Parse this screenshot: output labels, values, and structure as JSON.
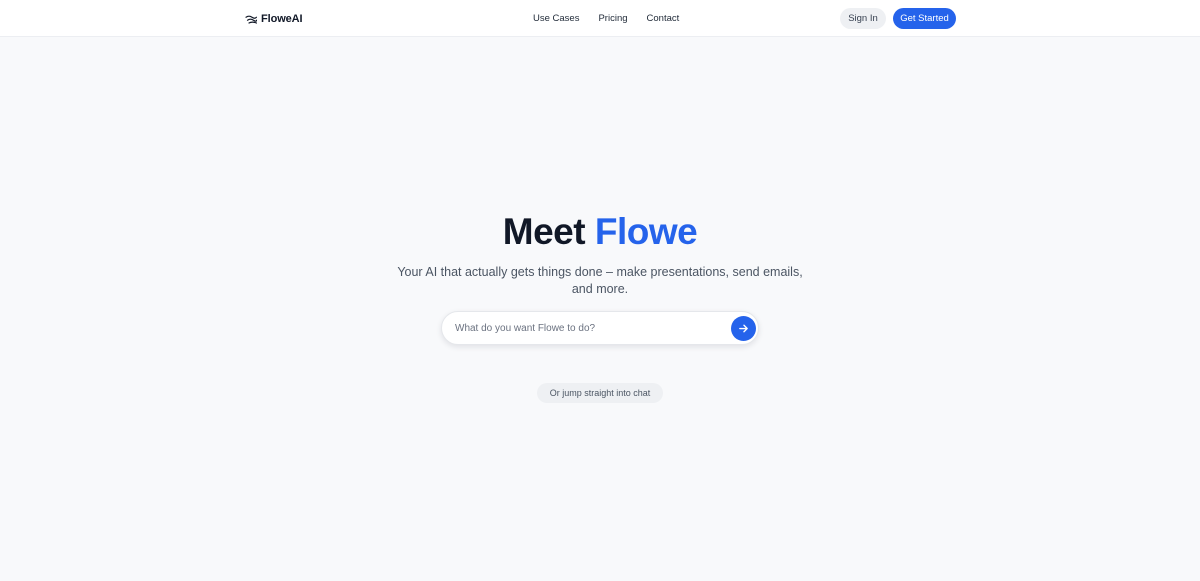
{
  "header": {
    "brand": {
      "name": "FloweAI",
      "icon": "flow-lines-icon"
    },
    "nav": [
      {
        "label": "Use Cases"
      },
      {
        "label": "Pricing"
      },
      {
        "label": "Contact"
      }
    ],
    "sign_in_label": "Sign In",
    "get_started_label": "Get Started"
  },
  "hero": {
    "title_part1": "Meet",
    "title_part2": "Flowe",
    "subtitle": "Your AI that actually gets things done – make presentations, send emails, and more.",
    "search": {
      "placeholder": "What do you want Flowe to do?",
      "value": "",
      "submit_icon": "arrow-right-icon"
    },
    "chat_link_label": "Or jump straight into chat"
  },
  "colors": {
    "accent": "#2563eb",
    "page_background": "#f8f9fb",
    "header_background": "#ffffff",
    "title_text": "#111827",
    "muted_button": "#eef0f3"
  }
}
